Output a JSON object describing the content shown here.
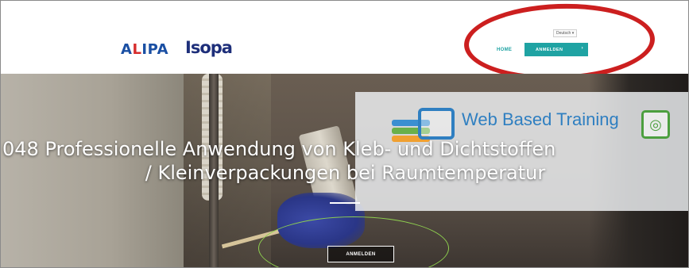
{
  "header": {
    "logo_left": "ALIPA",
    "logo_right": "Isopa",
    "language": "Deutsch ▾",
    "nav_home": "HOME",
    "nav_login": "ANMELDEN",
    "nav_login_arrow": "›"
  },
  "hero": {
    "title_line1": "048 Professionelle Anwendung von Kleb- und Dichtstoffen",
    "title_line2": "/ Kleinverpackungen bei Raumtemperatur",
    "login_button": "ANMELDEN",
    "overlay_text": "Web Based Training",
    "overlay_icon": "◎"
  },
  "colors": {
    "alipa_blue": "#1a4fa3",
    "alipa_red": "#d62c2c",
    "isopa_navy": "#1e2f7a",
    "nav_teal": "#1fa3a3",
    "annotation_red": "#cc1f1f",
    "annotation_green": "#8fd14f"
  },
  "icons": {
    "dropdown": "chevron-down-icon",
    "wbt_icon": "globe-icon"
  }
}
